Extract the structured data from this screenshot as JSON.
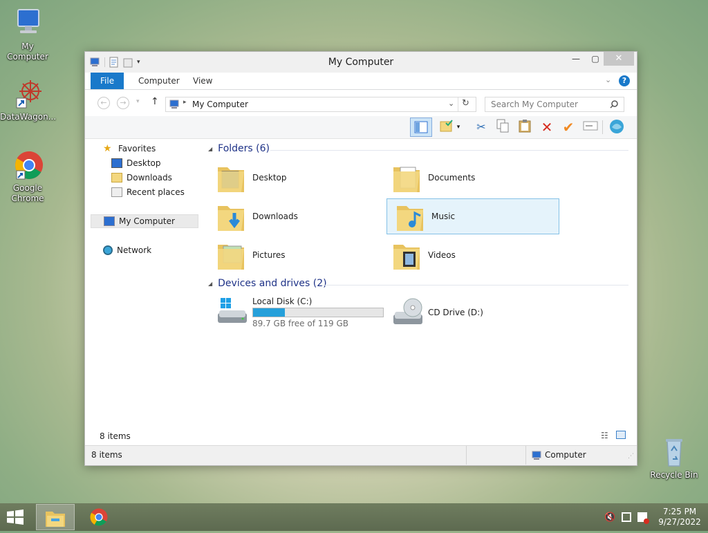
{
  "desktop": {
    "icons": [
      {
        "label": "My Computer"
      },
      {
        "label": "DataWagon..."
      },
      {
        "label": "Google Chrome"
      },
      {
        "label": "Recycle Bin"
      }
    ]
  },
  "window": {
    "title": "My Computer",
    "tabs": [
      "File",
      "Computer",
      "View"
    ],
    "address": "My Computer",
    "search_placeholder": "Search My Computer",
    "nav": {
      "favorites": "Favorites",
      "desktop": "Desktop",
      "downloads": "Downloads",
      "recent": "Recent places",
      "computer": "My Computer",
      "network": "Network"
    },
    "folders_header": "Folders (6)",
    "folders": [
      "Desktop",
      "Documents",
      "Downloads",
      "Music",
      "Pictures",
      "Videos"
    ],
    "drives_header": "Devices and drives (2)",
    "drives": {
      "c_label": "Local Disk (C:)",
      "c_free": "89.7 GB free of 119 GB",
      "c_used_fraction": 0.246,
      "d_label": "CD Drive (D:)"
    },
    "status_count": "8 items",
    "status_count_bottom": "8 items",
    "status_location": "Computer"
  },
  "taskbar": {
    "time": "7:25 PM",
    "date": "9/27/2022"
  },
  "colors": {
    "accent": "#1979ca",
    "folder": "#f3d77f",
    "selection": "#e5f3fb",
    "drive_bar": "#26a0da"
  }
}
